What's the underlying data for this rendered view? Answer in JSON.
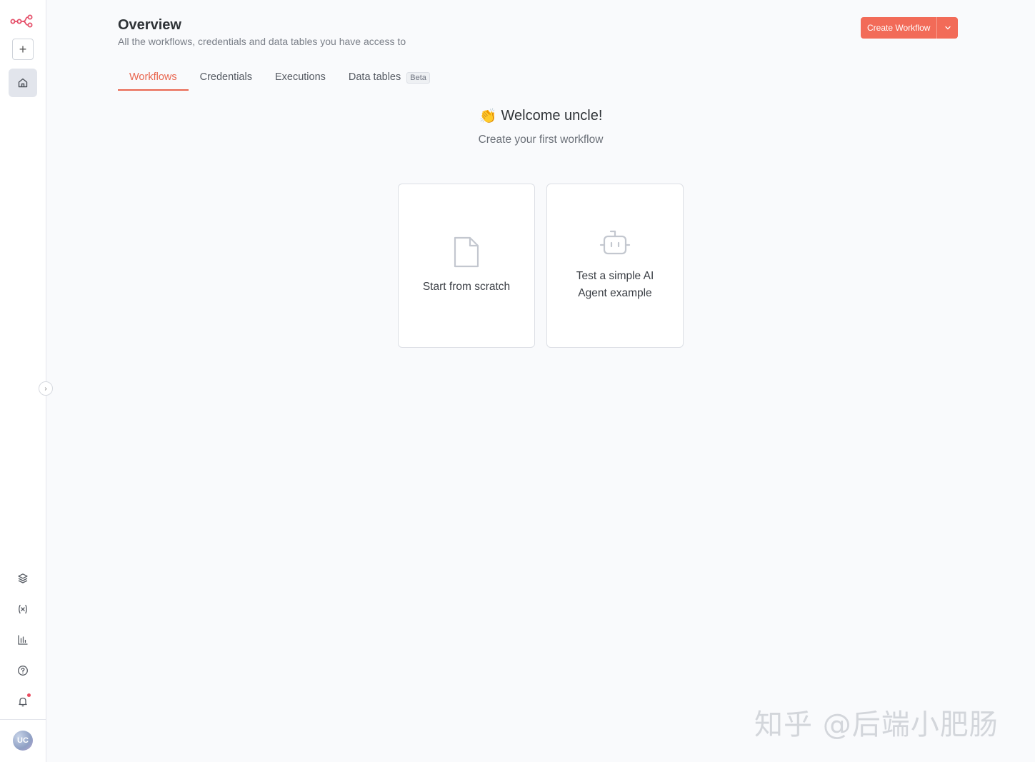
{
  "sidebar": {
    "add_label": "+",
    "avatar_initials": "UC",
    "icons": [
      "n8n-logo-icon",
      "plus-icon",
      "home-icon",
      "templates-icon",
      "variables-icon",
      "insights-icon",
      "help-icon",
      "bell-icon"
    ]
  },
  "header": {
    "title": "Overview",
    "subtitle": "All the workflows, credentials and data tables you have access to",
    "create_label": "Create Workflow"
  },
  "tabs": [
    {
      "label": "Workflows",
      "active": true
    },
    {
      "label": "Credentials",
      "active": false
    },
    {
      "label": "Executions",
      "active": false
    },
    {
      "label": "Data tables",
      "active": false,
      "badge": "Beta"
    }
  ],
  "welcome": {
    "emoji": "👏",
    "title": "Welcome uncle!",
    "subtitle": "Create your first workflow"
  },
  "cards": [
    {
      "label": "Start from scratch",
      "icon": "file-icon"
    },
    {
      "label_line1": "Test a simple AI",
      "label_line2": "Agent example",
      "icon": "robot-icon"
    }
  ],
  "watermark": "知乎 @后端小肥肠",
  "colors": {
    "accent": "#f26b58",
    "tab_active": "#e9664f",
    "background": "#f9fafc"
  }
}
